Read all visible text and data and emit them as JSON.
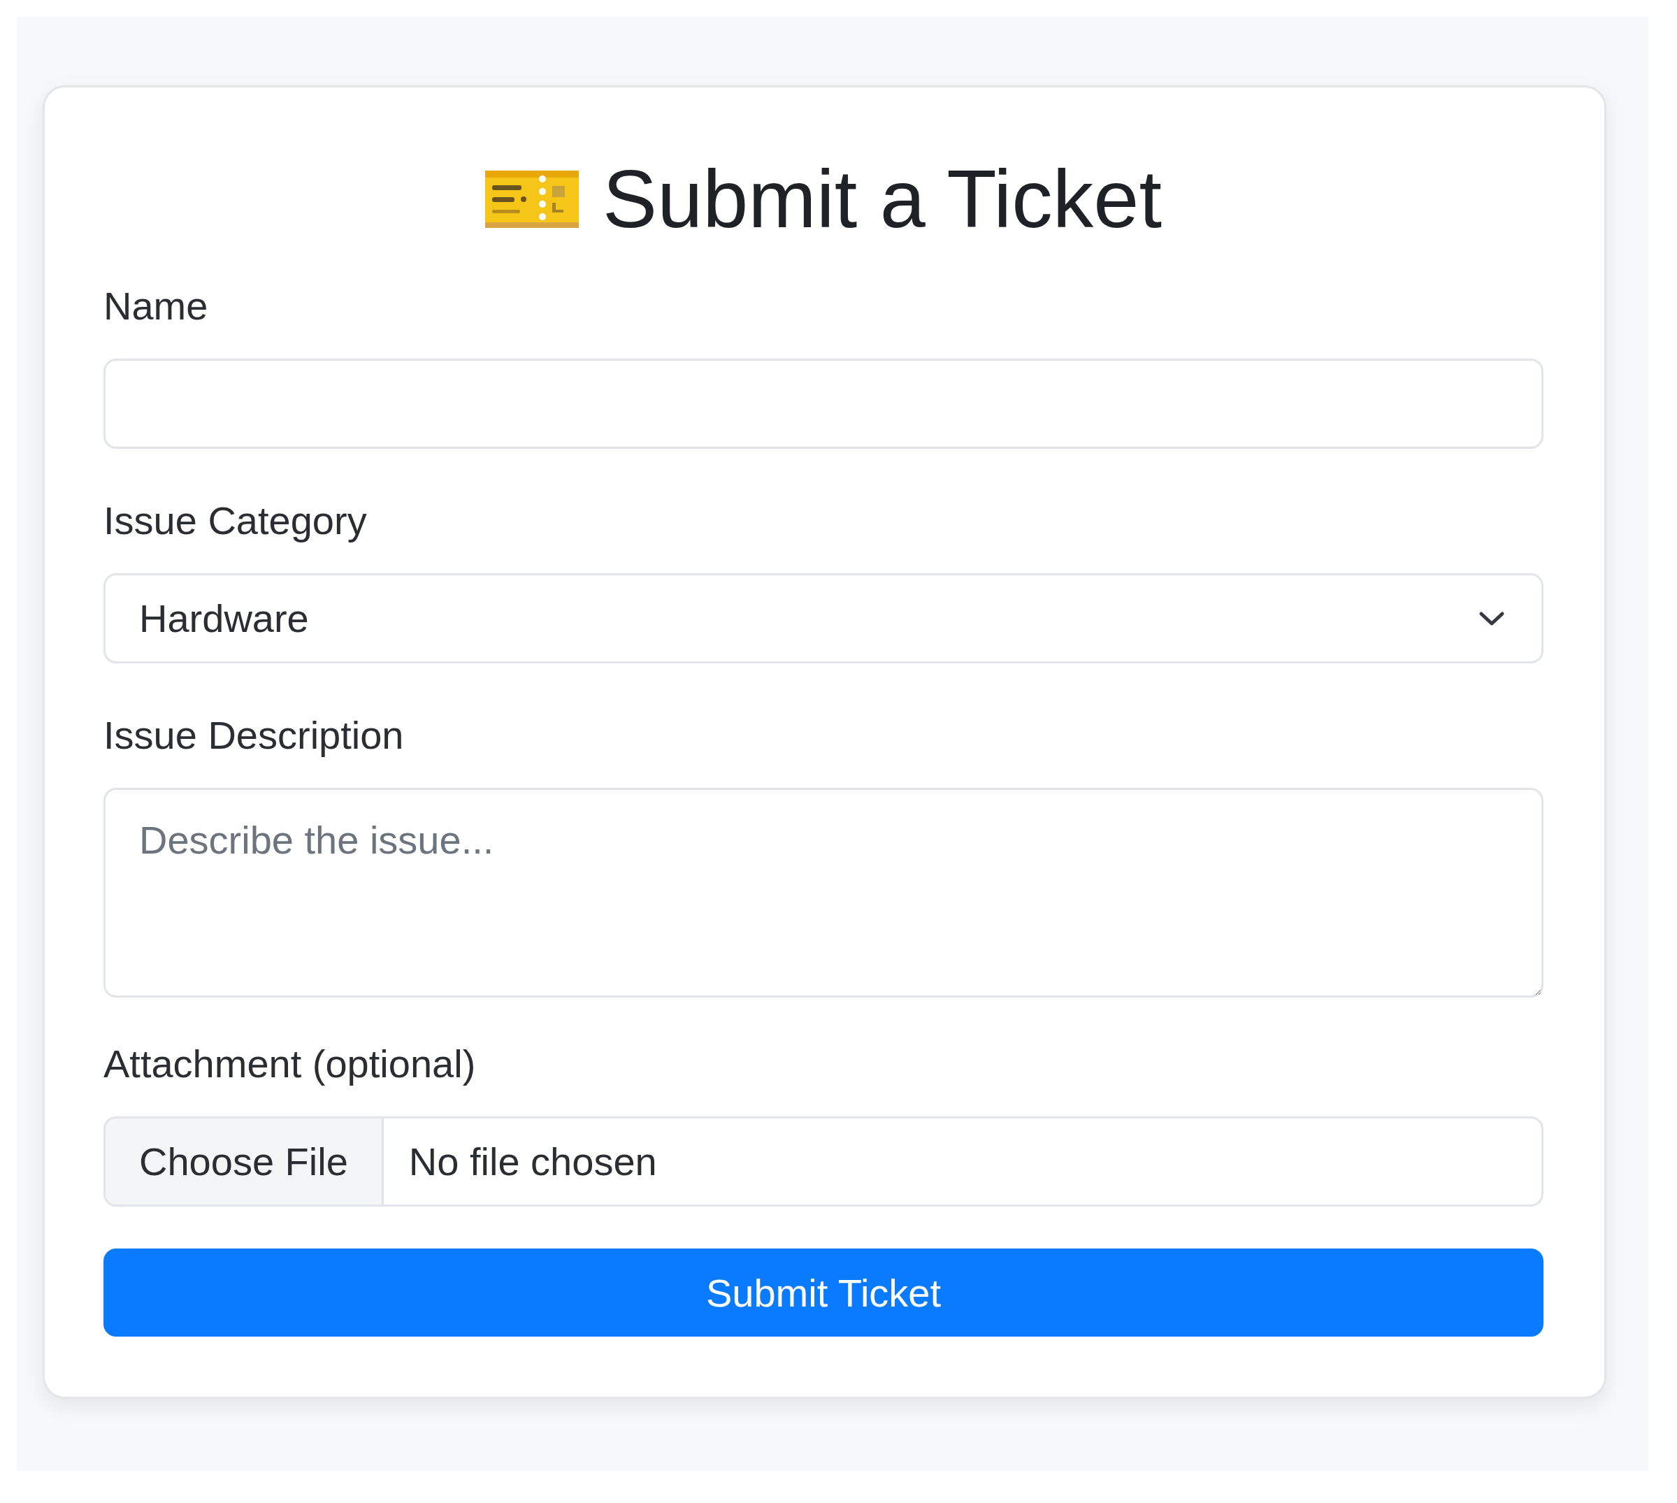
{
  "card": {
    "title": "Submit a Ticket",
    "fields": [
      {
        "kind": "text",
        "label": "Name"
      },
      {
        "kind": "select",
        "label": "Issue Category",
        "value": "Hardware"
      },
      {
        "kind": "textarea",
        "label": "Issue Description",
        "placeholder": "Describe the issue..."
      },
      {
        "kind": "file",
        "label": "Attachment (optional)",
        "button": "Choose File",
        "status": "No file chosen"
      }
    ],
    "submit_button": "Submit Ticket"
  }
}
